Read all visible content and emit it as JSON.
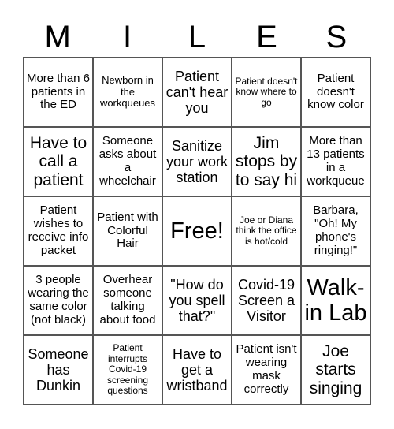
{
  "title_letters": [
    "M",
    "I",
    "L",
    "E",
    "S"
  ],
  "cells": [
    [
      "More than 6 patients in the ED",
      "Newborn in the workqueues",
      "Patient can't hear you",
      "Patient doesn't know where to go",
      "Patient doesn't know color"
    ],
    [
      "Have to call a patient",
      "Someone asks about a wheelchair",
      "Sanitize your work station",
      "Jim stops by to say hi",
      "More than 13 patients in a workqueue"
    ],
    [
      "Patient wishes to receive info packet",
      "Patient with Colorful Hair",
      "Free!",
      "Joe or Diana think the office is hot/cold",
      "Barbara, \"Oh! My phone's ringing!\""
    ],
    [
      "3 people wearing the same color (not black)",
      "Overhear someone talking about food",
      "\"How do you spell that?\"",
      "Covid-19 Screen a Visitor",
      "Walk-in Lab"
    ],
    [
      "Someone has Dunkin",
      "Patient interrupts Covid-19 screening questions",
      "Have to get a wristband",
      "Patient isn't wearing mask correctly",
      "Joe starts singing"
    ]
  ]
}
